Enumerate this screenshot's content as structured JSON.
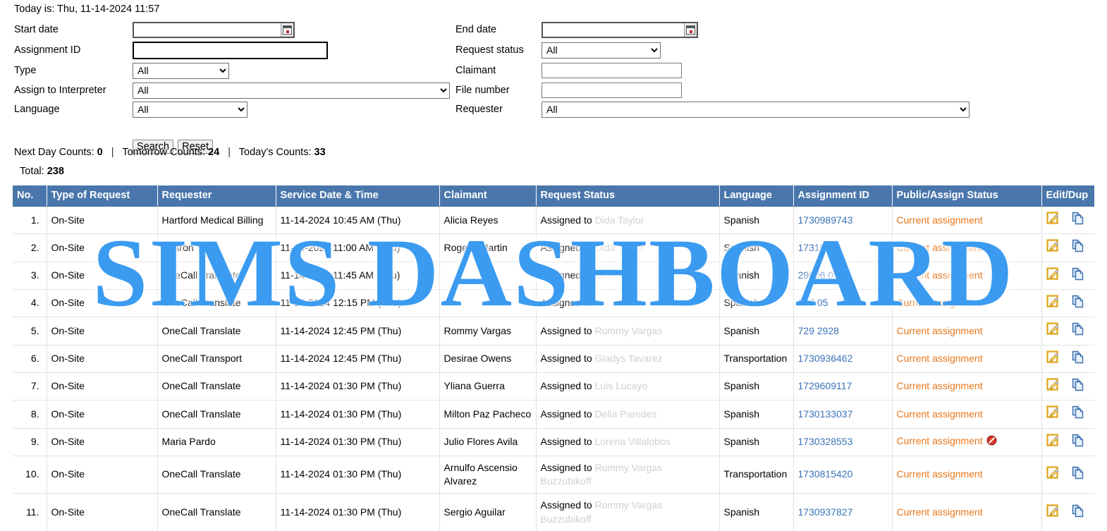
{
  "header": {
    "today_label": "Today is: Thu, 11-14-2024 11:57"
  },
  "watermark": {
    "text": "SIMS DASHBOARD",
    "color": "#3a9bf0"
  },
  "search_form": {
    "left": {
      "start_date": {
        "label": "Start date",
        "value": "",
        "placeholder": ""
      },
      "assignment_id": {
        "label": "Assignment ID",
        "value": "",
        "placeholder": ""
      },
      "type": {
        "label": "Type",
        "value": "All",
        "options": [
          "All"
        ]
      },
      "assign_to_interpreter": {
        "label": "Assign to Interpreter",
        "value": "All",
        "options": [
          "All"
        ]
      },
      "language": {
        "label": "Language",
        "value": "All",
        "options": [
          "All"
        ]
      }
    },
    "right": {
      "end_date": {
        "label": "End date",
        "value": "",
        "placeholder": ""
      },
      "request_status": {
        "label": "Request status",
        "value": "All",
        "options": [
          "All"
        ]
      },
      "claimant": {
        "label": "Claimant",
        "value": "",
        "placeholder": ""
      },
      "file_number": {
        "label": "File number",
        "value": "",
        "placeholder": ""
      },
      "requester": {
        "label": "Requester",
        "value": "All",
        "options": [
          "All"
        ]
      }
    },
    "buttons": {
      "search": "Search",
      "reset": "Reset"
    }
  },
  "counts": {
    "next_day_label": "Next Day Counts:",
    "next_day_value": "0",
    "tomorrow_label": "Tomorrow Counts:",
    "tomorrow_value": "24",
    "today_label": "Today's Counts:",
    "today_value": "33",
    "separator": "|",
    "total_label": "Total:",
    "total_value": "238"
  },
  "table": {
    "columns": [
      "No.",
      "Type of Request",
      "Requester",
      "Service Date & Time",
      "Claimant",
      "Request Status",
      "Language",
      "Assignment ID",
      "Public/Assign Status",
      "Edit/Dup"
    ],
    "rows": [
      {
        "no": "1.",
        "type": "On-Site",
        "requester": "Hartford Medical Billing",
        "service_datetime": "11-14-2024 10:45 AM (Thu)",
        "claimant": "Alicia Reyes",
        "request_status": "Assigned to Dida Taylor",
        "language": "Spanish",
        "assignment_id": "1730989743",
        "public_assign_status": "Current assignment",
        "blocked": false
      },
      {
        "no": "2.",
        "type": "On-Site",
        "requester": "Sharon Y",
        "service_datetime": "11-14-2024 11:00 AM (Thu)",
        "claimant": "Rogelio Martin",
        "request_status": "Assigned to Dida Taylor",
        "language": "Spanish",
        "assignment_id": "1731539",
        "public_assign_status": "Current assignment",
        "blocked": false
      },
      {
        "no": "3.",
        "type": "On-Site",
        "requester": "OneCall Translate",
        "service_datetime": "11-14-2024 11:45 AM (Thu)",
        "claimant": "",
        "request_status": "Assigned to M",
        "language": "Spanish",
        "assignment_id": "29006 06",
        "public_assign_status": "Current assignment",
        "blocked": false
      },
      {
        "no": "4.",
        "type": "On-Site",
        "requester": "OneCall Translate",
        "service_datetime": "11-14-2024 12:15 PM (Thu)",
        "claimant": "",
        "request_status": "Assigned to A",
        "language": "Spanish",
        "assignment_id": "297 05",
        "public_assign_status": "Current assignment",
        "blocked": false
      },
      {
        "no": "5.",
        "type": "On-Site",
        "requester": "OneCall Translate",
        "service_datetime": "11-14-2024 12:45 PM (Thu)",
        "claimant": "Rommy Vargas",
        "request_status": "Assigned to Rommy Vargas",
        "language": "Spanish",
        "assignment_id": "729 2928",
        "public_assign_status": "Current assignment",
        "blocked": false
      },
      {
        "no": "6.",
        "type": "On-Site",
        "requester": "OneCall Transport",
        "service_datetime": "11-14-2024 12:45 PM (Thu)",
        "claimant": "Desirae Owens",
        "request_status": "Assigned to Gladys Tavarez",
        "language": "Transportation",
        "assignment_id": "1730936462",
        "public_assign_status": "Current assignment",
        "blocked": false
      },
      {
        "no": "7.",
        "type": "On-Site",
        "requester": "OneCall Translate",
        "service_datetime": "11-14-2024 01:30 PM (Thu)",
        "claimant": "Yliana Guerra",
        "request_status": "Assigned to Luis Lucayo",
        "language": "Spanish",
        "assignment_id": "1729609117",
        "public_assign_status": "Current assignment",
        "blocked": false
      },
      {
        "no": "8.",
        "type": "On-Site",
        "requester": "OneCall Translate",
        "service_datetime": "11-14-2024 01:30 PM (Thu)",
        "claimant": "Milton Paz Pacheco",
        "request_status": "Assigned to Delia Paredes",
        "language": "Spanish",
        "assignment_id": "1730133037",
        "public_assign_status": "Current assignment",
        "blocked": false
      },
      {
        "no": "9.",
        "type": "On-Site",
        "requester": "Maria Pardo",
        "service_datetime": "11-14-2024 01:30 PM (Thu)",
        "claimant": "Julio Flores Avila",
        "request_status": "Assigned to Lorena Villalobos",
        "language": "Spanish",
        "assignment_id": "1730328553",
        "public_assign_status": "Current assignment",
        "blocked": true
      },
      {
        "no": "10.",
        "type": "On-Site",
        "requester": "OneCall Translate",
        "service_datetime": "11-14-2024 01:30 PM (Thu)",
        "claimant": "Arnulfo Ascensio Alvarez",
        "request_status": "Assigned to Rommy Vargas Buzzubikoff",
        "language": "Transportation",
        "assignment_id": "1730815420",
        "public_assign_status": "Current assignment",
        "blocked": false
      },
      {
        "no": "11.",
        "type": "On-Site",
        "requester": "OneCall Translate",
        "service_datetime": "11-14-2024 01:30 PM (Thu)",
        "claimant": "Sergio Aguilar",
        "request_status": "Assigned to Rommy Vargas Buzzubikoff",
        "language": "Spanish",
        "assignment_id": "1730937827",
        "public_assign_status": "Current assignment",
        "blocked": false
      }
    ],
    "icons": {
      "edit": "edit-pencil-icon",
      "duplicate": "duplicate-pages-icon",
      "blocked": "no-entry-icon"
    },
    "accent_colors": {
      "header_bg": "#4a77ab",
      "link": "#3b73b9",
      "assignment_status": "#e8761a",
      "edit_icon": "#e0a81e",
      "dup_icon": "#4a7ec0",
      "blocked_icon": "#cc2222"
    }
  }
}
